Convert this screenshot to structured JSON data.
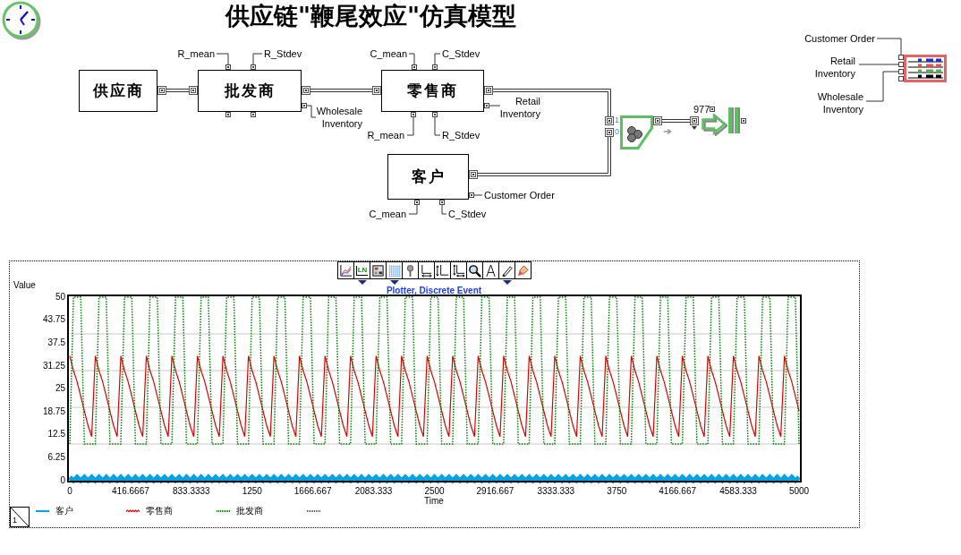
{
  "title": "供应链\"鞭尾效应\"仿真模型",
  "blocks": [
    {
      "label": "供应商"
    },
    {
      "label": "批发商",
      "params_top": [
        "R_mean",
        "R_Stdev"
      ],
      "output": "Wholesale Inventory"
    },
    {
      "label": "零售商",
      "params_top": [
        "C_mean",
        "C_Stdev"
      ],
      "params_bottom": [
        "R_mean",
        "R_Stdev"
      ],
      "output": "Retail Inventory"
    },
    {
      "label": "客户",
      "params_bottom": [
        "C_mean",
        "C_Stdev"
      ],
      "output": "Customer Order"
    }
  ],
  "merge": {
    "inputs": [
      "1",
      "0"
    ]
  },
  "exit": {
    "count": "977"
  },
  "plotter_block": {
    "inputs": [
      "Customer Order",
      "Retail Inventory",
      "Wholesale Inventory"
    ]
  },
  "plot": {
    "toolbar": [
      {
        "kind": "chart",
        "dropdown": false
      },
      {
        "kind": "labels",
        "label": "LN",
        "dropdown": true
      },
      {
        "kind": "table",
        "dropdown": false
      },
      {
        "kind": "grid",
        "dropdown": true
      },
      {
        "kind": "pin",
        "dropdown": false
      },
      {
        "kind": "xaxis",
        "dropdown": false
      },
      {
        "kind": "yaxis",
        "dropdown": false
      },
      {
        "kind": "xyaxis",
        "dropdown": false
      },
      {
        "kind": "zoom",
        "dropdown": false
      },
      {
        "kind": "compass",
        "dropdown": false
      },
      {
        "kind": "pen",
        "dropdown": true
      },
      {
        "kind": "brush",
        "dropdown": false
      }
    ],
    "chart_data": {
      "type": "line",
      "title": "Plotter, Discrete Event",
      "xlabel": "Time",
      "ylabel": "Value",
      "x": [
        0,
        25,
        50,
        75,
        100,
        125,
        150,
        175,
        200,
        225,
        250,
        275,
        300,
        325,
        350,
        375,
        400,
        425,
        450,
        475,
        500,
        525,
        550,
        575,
        600,
        625,
        650,
        675,
        700,
        725,
        750,
        775,
        800,
        825,
        850,
        875,
        900,
        925,
        950,
        975,
        1000,
        1025,
        1050,
        1075,
        1100,
        1125,
        1150,
        1175,
        1200,
        1225,
        1250,
        1275,
        1300,
        1325,
        1350,
        1375,
        1400,
        1425,
        1450,
        1475,
        1500,
        1525,
        1550,
        1575,
        1600,
        1625,
        1650,
        1675,
        1700,
        1725,
        1750,
        1775,
        1800,
        1825,
        1850,
        1875,
        1900,
        1925,
        1950,
        1975,
        2000,
        2025,
        2050,
        2075,
        2100,
        2125,
        2150,
        2175,
        2200,
        2225,
        2250,
        2275,
        2300,
        2325,
        2350,
        2375,
        2400,
        2425,
        2450,
        2475,
        2500,
        2525,
        2550,
        2575,
        2600,
        2625,
        2650,
        2675,
        2700,
        2725,
        2750,
        2775,
        2800,
        2825,
        2850,
        2875,
        2900,
        2925,
        2950,
        2975,
        3000,
        3025,
        3050,
        3075,
        3100,
        3125,
        3150,
        3175,
        3200,
        3225,
        3250,
        3275,
        3300,
        3325,
        3350,
        3375,
        3400,
        3425,
        3450,
        3475,
        3500,
        3525,
        3550,
        3575,
        3600,
        3625,
        3650,
        3675,
        3700,
        3725,
        3750,
        3775,
        3800,
        3825,
        3850,
        3875,
        3900,
        3925,
        3950,
        3975,
        4000,
        4025,
        4050,
        4075,
        4100,
        4125,
        4150,
        4175,
        4200,
        4225,
        4250,
        4275,
        4300,
        4325,
        4350,
        4375,
        4400,
        4425,
        4450,
        4475,
        4500,
        4525,
        4550,
        4575,
        4600,
        4625,
        4650,
        4675,
        4700,
        4725,
        4750,
        4775,
        4800,
        4825,
        4850,
        4875,
        4900,
        4925,
        4950,
        4975,
        5000
      ],
      "series": [
        {
          "name": "客户",
          "color": "#00a2e8",
          "line_style": "solid",
          "values": [
            1,
            0,
            1,
            0,
            1,
            0,
            1,
            0,
            1,
            0,
            1,
            0,
            1,
            0,
            1,
            0,
            1,
            0,
            1,
            0,
            1,
            0,
            1,
            0,
            1,
            0,
            1,
            0,
            1,
            0,
            1,
            0,
            1,
            0,
            1,
            0,
            1,
            0,
            1,
            0,
            1,
            0,
            1,
            0,
            1,
            0,
            1,
            0,
            1,
            0,
            1,
            0,
            1,
            0,
            1,
            0,
            1,
            0,
            1,
            0,
            1,
            0,
            1,
            0,
            1,
            0,
            1,
            0,
            1,
            0,
            1,
            0,
            1,
            0,
            1,
            0,
            1,
            0,
            1,
            0,
            1,
            0,
            1,
            0,
            1,
            0,
            1,
            0,
            1,
            0,
            1,
            0,
            1,
            0,
            1,
            0,
            1,
            0,
            1,
            0,
            1,
            0,
            1,
            0,
            1,
            0,
            1,
            0,
            1,
            0,
            1,
            0,
            1,
            0,
            1,
            0,
            1,
            0,
            1,
            0,
            1,
            0,
            1,
            0,
            1,
            0,
            1,
            0,
            1,
            0,
            1,
            0,
            1,
            0,
            1,
            0,
            1,
            0,
            1,
            0,
            1,
            0,
            1,
            0,
            1,
            0,
            1,
            0,
            1,
            0,
            1,
            0,
            1,
            0,
            1,
            0,
            1,
            0,
            1,
            0,
            1,
            0,
            1,
            0,
            1,
            0,
            1,
            0,
            1,
            0,
            1,
            0,
            1,
            0,
            1,
            0,
            1,
            0,
            1,
            0,
            1,
            0,
            1,
            0,
            1,
            0,
            1,
            0,
            1,
            0,
            1,
            0,
            1,
            0,
            1,
            0,
            1,
            0,
            1,
            0,
            1
          ]
        },
        {
          "name": "零售商",
          "color": "#e00000",
          "line_style": "solid",
          "values": [
            34,
            30,
            27,
            23,
            19,
            15,
            12,
            34,
            30,
            27,
            23,
            19,
            15,
            12,
            34,
            30,
            27,
            23,
            19,
            15,
            12,
            34,
            30,
            27,
            23,
            19,
            15,
            12,
            34,
            30,
            27,
            23,
            19,
            15,
            12,
            34,
            30,
            27,
            23,
            19,
            15,
            12,
            34,
            30,
            27,
            23,
            19,
            15,
            12,
            34,
            30,
            27,
            23,
            19,
            15,
            12,
            34,
            30,
            27,
            23,
            19,
            15,
            12,
            34,
            30,
            27,
            23,
            19,
            15,
            12,
            34,
            30,
            27,
            23,
            19,
            15,
            12,
            34,
            30,
            27,
            23,
            19,
            15,
            12,
            34,
            30,
            27,
            23,
            19,
            15,
            12,
            34,
            30,
            27,
            23,
            19,
            15,
            12,
            34,
            30,
            27,
            23,
            19,
            15,
            12,
            34,
            30,
            27,
            23,
            19,
            15,
            12,
            34,
            30,
            27,
            23,
            19,
            15,
            12,
            34,
            30,
            27,
            23,
            19,
            15,
            12,
            34,
            30,
            27,
            23,
            19,
            15,
            12,
            34,
            30,
            27,
            23,
            19,
            15,
            12,
            34,
            30,
            27,
            23,
            19,
            15,
            12,
            34,
            30,
            27,
            23,
            19,
            15,
            12,
            34,
            30,
            27,
            23,
            19,
            15,
            12,
            34,
            30,
            27,
            23,
            19,
            15,
            12,
            34,
            30,
            27,
            23,
            19,
            15,
            12,
            34,
            30,
            27,
            23,
            19,
            15,
            12,
            34,
            30,
            27,
            23,
            19,
            15,
            12,
            34,
            30,
            27,
            23,
            19,
            15,
            12,
            34,
            30,
            27,
            23,
            19
          ]
        },
        {
          "name": "批发商",
          "color": "#008000",
          "line_style": "dotted",
          "values": [
            10,
            50,
            50,
            50,
            10,
            10,
            10,
            10,
            50,
            50,
            50,
            10,
            10,
            10,
            10,
            50,
            50,
            50,
            10,
            10,
            10,
            10,
            50,
            50,
            50,
            10,
            10,
            10,
            10,
            50,
            50,
            50,
            10,
            10,
            10,
            10,
            50,
            50,
            50,
            10,
            10,
            10,
            10,
            50,
            50,
            50,
            10,
            10,
            10,
            10,
            50,
            50,
            50,
            10,
            10,
            10,
            10,
            50,
            50,
            50,
            10,
            10,
            10,
            10,
            50,
            50,
            50,
            10,
            10,
            10,
            10,
            50,
            50,
            50,
            10,
            10,
            10,
            10,
            50,
            50,
            50,
            10,
            10,
            10,
            10,
            50,
            50,
            50,
            10,
            10,
            10,
            10,
            50,
            50,
            50,
            10,
            10,
            10,
            10,
            50,
            50,
            50,
            10,
            10,
            10,
            10,
            50,
            50,
            50,
            10,
            10,
            10,
            10,
            50,
            50,
            50,
            10,
            10,
            10,
            10,
            50,
            50,
            50,
            10,
            10,
            10,
            10,
            50,
            50,
            50,
            10,
            10,
            10,
            10,
            50,
            50,
            50,
            10,
            10,
            10,
            10,
            50,
            50,
            50,
            10,
            10,
            10,
            10,
            50,
            50,
            50,
            10,
            10,
            10,
            10,
            50,
            50,
            50,
            10,
            10,
            10,
            10,
            50,
            50,
            50,
            10,
            10,
            10,
            10,
            50,
            50,
            50,
            10,
            10,
            10,
            10,
            50,
            50,
            50,
            10,
            10,
            10,
            10,
            50,
            50,
            50,
            10,
            10,
            10,
            10,
            50,
            50,
            50,
            10,
            10,
            10,
            10,
            50,
            50,
            50,
            10
          ]
        }
      ],
      "xlim": [
        0,
        5000
      ],
      "ylim": [
        0,
        50
      ],
      "xticks": [
        0,
        416.6667,
        833.3333,
        1250,
        1666.667,
        2083.333,
        2500,
        2916.667,
        3333.333,
        3750,
        4166.667,
        4583.333,
        5000
      ],
      "yticks": [
        0,
        6.25,
        12.5,
        18.75,
        25,
        31.25,
        37.5,
        43.75,
        50
      ],
      "legend": "bottom"
    },
    "legend": [
      {
        "kind": "solid"
      },
      {
        "kind": "wavy"
      },
      {
        "kind": "dotted"
      },
      {
        "kind": "dotted",
        "color": "#3030ff"
      }
    ],
    "page_tab": "1"
  }
}
